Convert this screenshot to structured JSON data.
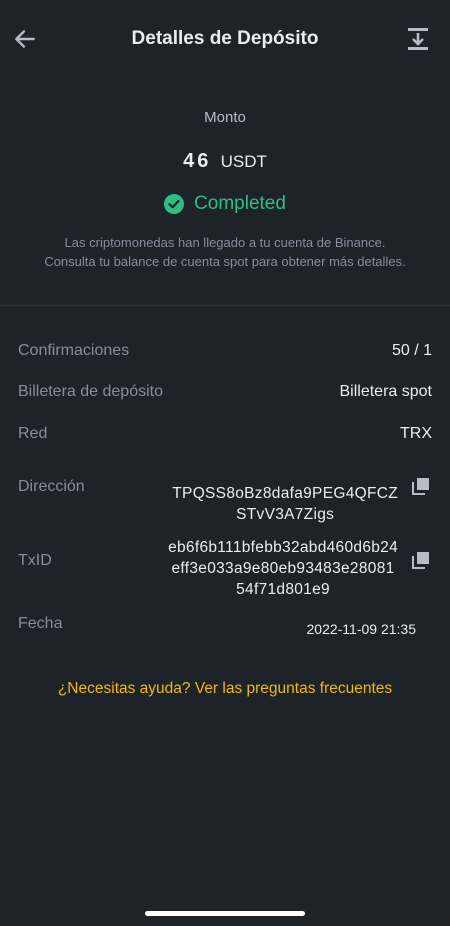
{
  "header": {
    "title": "Detalles de Depósito",
    "back_icon": "arrow-left-icon",
    "export_icon": "export-icon"
  },
  "summary": {
    "amount_label": "Monto",
    "amount_value": "46",
    "amount_unit": "USDT",
    "status": "Completed",
    "status_color": "#2ebd85",
    "note_line1": "Las criptomonedas han llegado a tu cuenta de Binance.",
    "note_line2": "Consulta tu balance de cuenta spot para obtener más detalles."
  },
  "details": {
    "confirmations_label": "Confirmaciones",
    "confirmations_value": "50 / 1",
    "wallet_label": "Billetera de depósito",
    "wallet_value": "Billetera spot",
    "network_label": "Red",
    "network_value": "TRX",
    "address_label": "Dirección",
    "address_line1": "TPQSS8oBz8dafa9PEG4QFCZ",
    "address_line2": "STvV3A7Zigs",
    "txid_label": "TxID",
    "txid_line1": "eb6f6b111bfebb32abd460d6b24",
    "txid_line2": "eff3e033a9e80eb93483e28081",
    "txid_line3": "54f71d801e9",
    "date_label": "Fecha",
    "date_value": "2022-11-09 21:35"
  },
  "help_link": "¿Necesitas ayuda? Ver las preguntas frecuentes",
  "colors": {
    "background": "#1e2329",
    "accent": "#f0b90b",
    "success": "#2ebd85"
  }
}
